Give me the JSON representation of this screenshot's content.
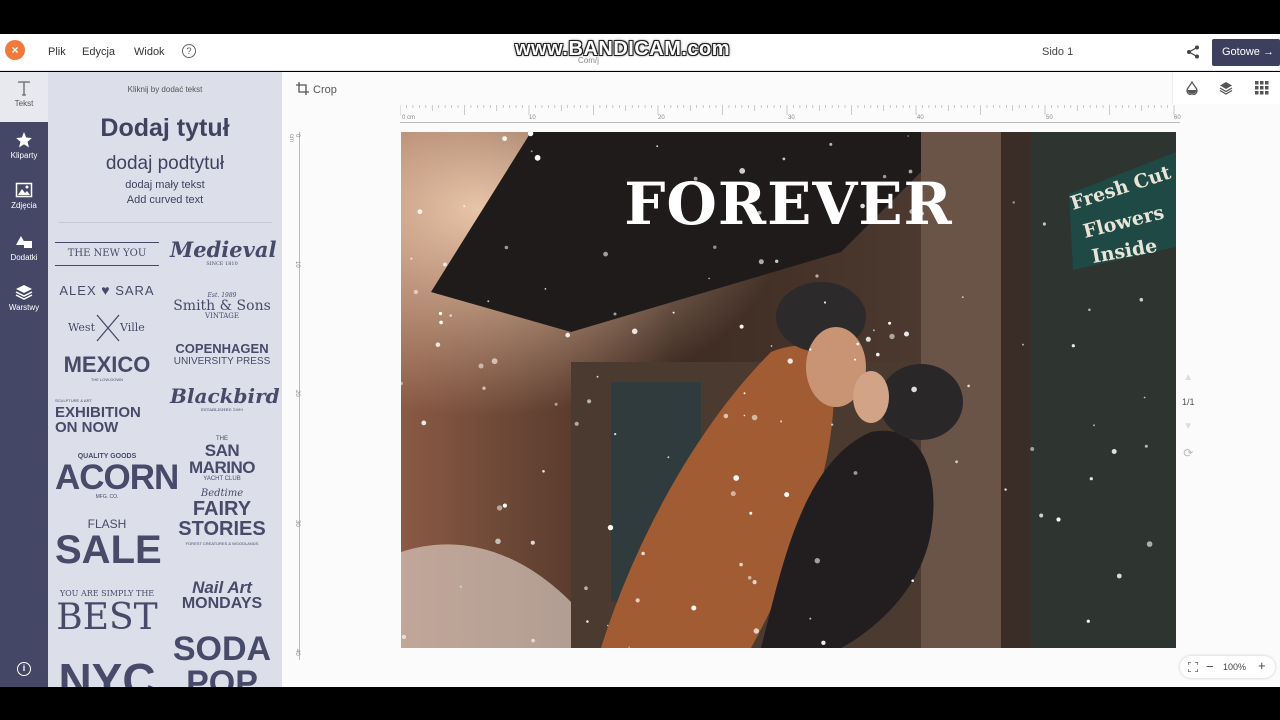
{
  "menu": {
    "close_icon": "×",
    "file": "Plik",
    "edit": "Edycja",
    "view": "Widok",
    "help": "?"
  },
  "watermark": "www.BANDICAM.com",
  "doc_name": "Com/j",
  "page_label": "Sido 1",
  "done_label": "Gotowe →",
  "tools": [
    {
      "label": "Tekst",
      "icon": "text-icon"
    },
    {
      "label": "Kliparty",
      "icon": "star-icon"
    },
    {
      "label": "Zdjęcia",
      "icon": "image-icon"
    },
    {
      "label": "Dodatki",
      "icon": "shapes-icon"
    },
    {
      "label": "Warstwy",
      "icon": "layers-icon"
    }
  ],
  "info": "i",
  "panel": {
    "hint": "Kliknij by dodać tekst",
    "title": "Dodaj tytuł",
    "subtitle": "dodaj podtytuł",
    "small": "dodaj mały tekst",
    "curved": "Add curved text"
  },
  "templates": {
    "newyou": "THE NEW YOU",
    "alex": "ALEX",
    "heart": "♥",
    "sara": "SARA",
    "west": "West",
    "ville": "Ville",
    "mexico": "MEXICO",
    "mexico_sub": "THE LOW-DOWN",
    "exhibition1": "EXHIBITION",
    "exhibition2": "ON NOW",
    "exhibition_sub": "SCULPTURE & ART",
    "quality": "QUALITY GOODS",
    "acorn": "ACORN",
    "acorn_sub": "MFG. CO.",
    "flash": "FLASH",
    "sale": "SALE",
    "simply": "YOU ARE SIMPLY THE",
    "best": "BEST",
    "nyc": "NYC",
    "medieval": "Medieval",
    "medieval_sub": "SINCE 1810",
    "smith_est": "Est. 1989",
    "smith": "Smith & Sons",
    "smith_sub": "VINTAGE",
    "copenhagen": "COPENHAGEN",
    "copenhagen_sub": "UNIVERSITY PRESS",
    "blackbird": "Blackbird",
    "blackbird_sub": "ESTABLISHED 1899",
    "the": "THE",
    "sanmarino": "SAN MARINO",
    "sanmarino_sub": "YACHT CLUB",
    "bedtime": "Bedtime",
    "fairy": "FAIRY",
    "stories": "STORIES",
    "fairy_sub": "FOREST CREATURES & WOODLANDS",
    "nailart": "Nail Art",
    "mondays": "MONDAYS",
    "soda": "SODA",
    "pop": "POP"
  },
  "crop_label": "Crop",
  "ruler_top": [
    "0 cm",
    "10",
    "20",
    "30",
    "40",
    "50",
    "60"
  ],
  "ruler_left": [
    "0 cm",
    "10",
    "20",
    "30",
    "40"
  ],
  "canvas_title": "FOREVER",
  "sign_text": [
    "Fresh Cut",
    "Flowers",
    "Inside"
  ],
  "page_nav": "1/1",
  "zoom_level": "100%",
  "zoom_minus": "−",
  "zoom_plus": "+"
}
